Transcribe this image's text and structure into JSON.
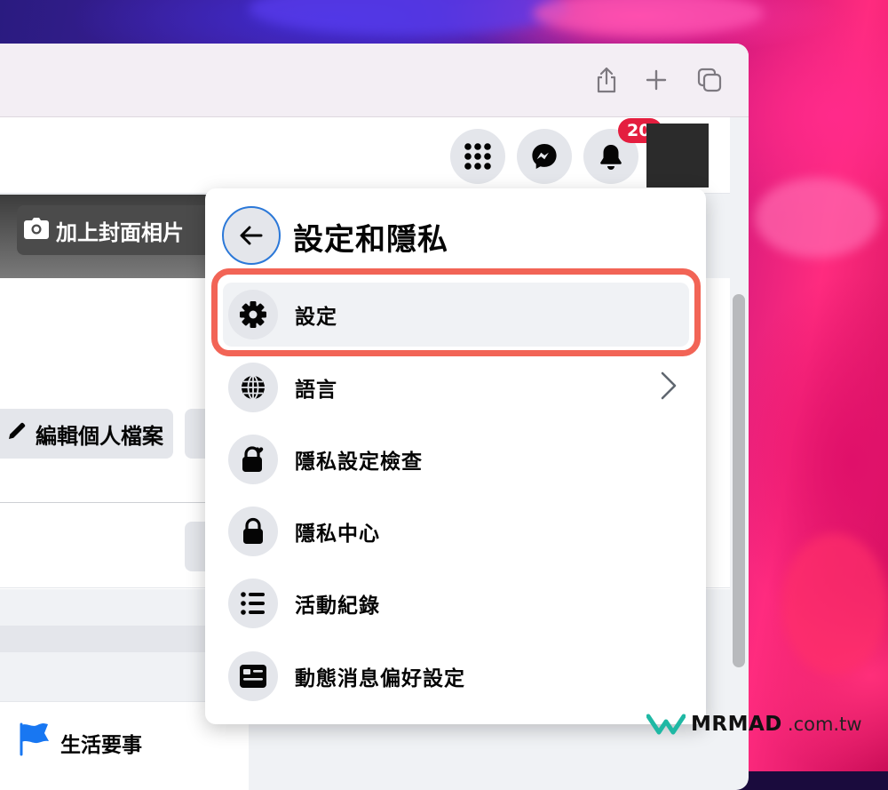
{
  "header": {
    "notification_count": "20"
  },
  "cover": {
    "add_cover_label": "加上封面相片"
  },
  "profile": {
    "edit_label": "編輯個人檔案"
  },
  "sidebar": {
    "life_events_label": "生活要事"
  },
  "menu": {
    "title": "設定和隱私",
    "items": [
      {
        "label": "設定",
        "icon": "gear-icon"
      },
      {
        "label": "語言",
        "icon": "globe-icon"
      },
      {
        "label": "隱私設定檢查",
        "icon": "lock-heart-icon"
      },
      {
        "label": "隱私中心",
        "icon": "lock-icon"
      },
      {
        "label": "活動紀錄",
        "icon": "list-icon"
      },
      {
        "label": "動態消息偏好設定",
        "icon": "news-feed-icon"
      }
    ]
  },
  "watermark": {
    "brand": "MRMAD",
    "domain": ".com.tw"
  },
  "colors": {
    "highlight": "#f26456",
    "badge": "#e41e3f",
    "facebook_blue": "#1877f2"
  }
}
